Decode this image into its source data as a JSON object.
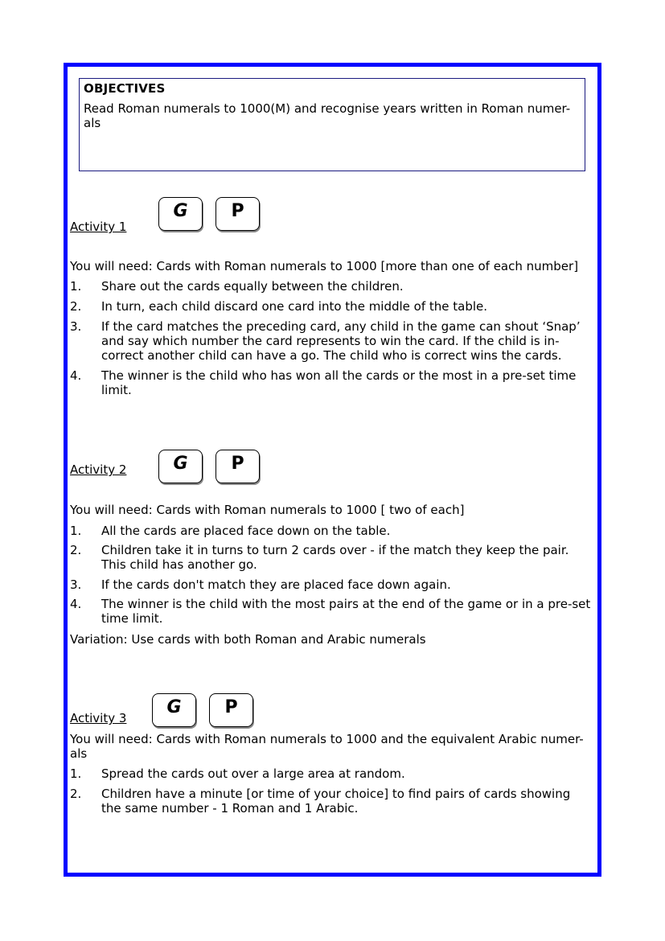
{
  "colors": {
    "frame_border": "#0000ff",
    "objectives_border": "#1a1a80"
  },
  "objectives": {
    "title": "OBJECTIVES",
    "text": "Read Roman numerals to 1000(M) and recognise years written in Roman numer-als"
  },
  "badges": {
    "group": "G",
    "pair": "P"
  },
  "activities": [
    {
      "label": "Activity 1",
      "need": "You will need:   Cards with Roman numerals to 1000 [more than one of each number]",
      "steps": [
        {
          "num": "1.",
          "text": "Share out the cards equally between the children."
        },
        {
          "num": "2.",
          "text": "In turn, each child discard one card into the middle of the table."
        },
        {
          "num": "3.",
          "text": "If the card matches the preceding card, any child in the game can shout ‘Snap’ and say which number the card represents to win the card. If the child is in-correct another child can have a go. The child who is correct wins the cards."
        },
        {
          "num": "4.",
          "text": "The winner is the child who has won all the cards or the most in a pre-set time limit."
        }
      ]
    },
    {
      "label": "Activity 2",
      "need": "You will need:   Cards with Roman numerals to 1000 [ two of each]",
      "steps": [
        {
          "num": "1.",
          "text": "All the cards are placed face down on the table."
        },
        {
          "num": "2.",
          "text": "Children take it in turns to turn 2 cards over - if the match they keep the pair. This child has another go."
        },
        {
          "num": "3.",
          "text": "If the cards don't match they are placed face down again."
        },
        {
          "num": "4.",
          "text": "The winner is the child with the most pairs at the end of the game or in a pre-set time limit."
        }
      ],
      "variation": "Variation: Use cards with both Roman and Arabic numerals"
    },
    {
      "label": "Activity 3",
      "need": "You will need: Cards with Roman numerals to 1000 and the equivalent Arabic numer-als",
      "steps": [
        {
          "num": "1.",
          "text": "Spread the cards out over a large area at random."
        },
        {
          "num": "2.",
          "text": "Children have a minute [or time of your choice] to find pairs of cards showing the same number - 1 Roman and 1 Arabic."
        }
      ]
    }
  ]
}
